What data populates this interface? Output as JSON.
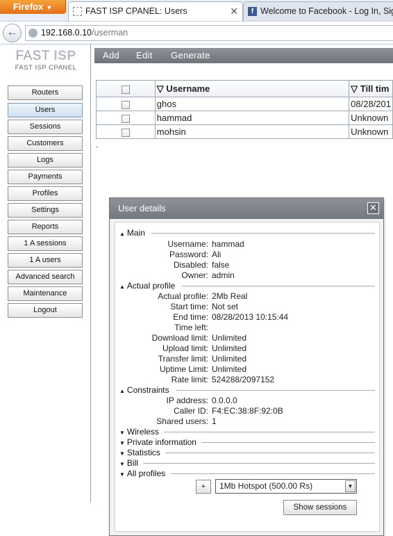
{
  "browser": {
    "menu_button": "Firefox",
    "tabs": [
      {
        "title": "FAST ISP CPANEL: Users",
        "active": true
      },
      {
        "title": "Welcome to Facebook - Log In, Sign",
        "active": false
      }
    ],
    "url_host": "192.168.0.10",
    "url_path": "/userman"
  },
  "logo": {
    "title_fast": "FAST",
    "title_isp": "ISP",
    "subtitle": "FAST ISP CPANEL"
  },
  "sidebar": {
    "items": [
      {
        "label": "Routers"
      },
      {
        "label": "Users"
      },
      {
        "label": "Sessions"
      },
      {
        "label": "Customers"
      },
      {
        "label": "Logs"
      },
      {
        "label": "Payments"
      },
      {
        "label": "Profiles"
      },
      {
        "label": "Settings"
      },
      {
        "label": "Reports"
      },
      {
        "label": "1 A sessions"
      },
      {
        "label": "1 A users"
      },
      {
        "label": "Advanced search"
      },
      {
        "label": "Maintenance"
      },
      {
        "label": "Logout"
      }
    ],
    "active": "Users"
  },
  "toolbar": {
    "add": "Add",
    "edit": "Edit",
    "generate": "Generate"
  },
  "table": {
    "headers": {
      "sort_icon": "▽",
      "username": "Username",
      "till_time": "Till tim"
    },
    "rows": [
      {
        "username": "ghos",
        "till_time": "08/28/201"
      },
      {
        "username": "hammad",
        "till_time": "Unknown"
      },
      {
        "username": "mohsin",
        "till_time": "Unknown"
      }
    ],
    "footer_mark": "."
  },
  "dialog": {
    "title": "User details",
    "close_symbol": "✕",
    "sections": {
      "main": "Main",
      "actual_profile": "Actual profile",
      "constraints": "Constraints",
      "wireless": "Wireless",
      "private_information": "Private information",
      "statistics": "Statistics",
      "bill": "Bill",
      "all_profiles": "All profiles"
    },
    "main": {
      "username_label": "Username:",
      "username": "hammad",
      "password_label": "Password:",
      "password": "Ali",
      "disabled_label": "Disabled:",
      "disabled": "false",
      "owner_label": "Owner:",
      "owner": "admin"
    },
    "actual_profile": {
      "actual_profile_label": "Actual profile:",
      "actual_profile": "2Mb Real",
      "start_time_label": "Start time:",
      "start_time": "Not set",
      "end_time_label": "End time:",
      "end_time": "08/28/2013 10:15:44",
      "time_left_label": "Time left:",
      "time_left": "",
      "download_limit_label": "Download limit:",
      "download_limit": "Unlimited",
      "upload_limit_label": "Upload limit:",
      "upload_limit": "Unlimited",
      "transfer_limit_label": "Transfer limit:",
      "transfer_limit": "Unlimited",
      "uptime_limit_label": "Uptime Limit:",
      "uptime_limit": "Unlimited",
      "rate_limit_label": "Rate limit:",
      "rate_limit": "524288/2097152"
    },
    "constraints": {
      "ip_address_label": "IP address:",
      "ip_address": "0.0.0.0",
      "caller_id_label": "Caller ID:",
      "caller_id": "F4:EC:38:8F:92:0B",
      "shared_users_label": "Shared users:",
      "shared_users": "1"
    },
    "all_profiles": {
      "add_button": "+",
      "selected_profile": "1Mb Hotspot (500.00 Rs)",
      "show_sessions": "Show sessions"
    }
  }
}
